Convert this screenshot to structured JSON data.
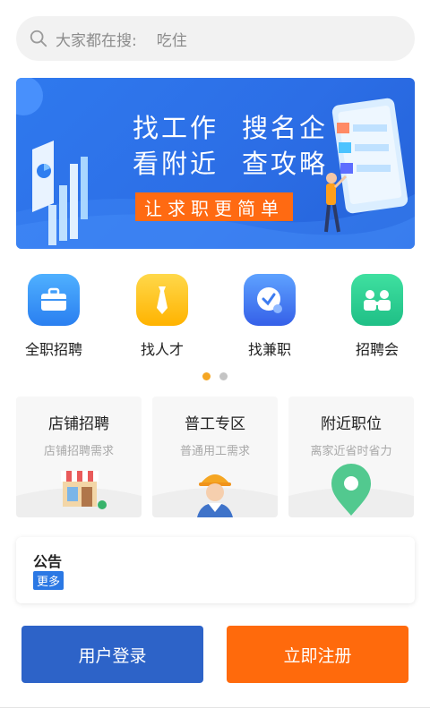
{
  "search": {
    "placeholder": "大家都在搜:",
    "hot_keyword": "吃住"
  },
  "banner": {
    "line1_a": "找工作",
    "line1_b": "搜名企",
    "line2_a": "看附近",
    "line2_b": "查攻略",
    "cta": "让求职更简单"
  },
  "categories": [
    {
      "label": "全职招聘",
      "icon": "briefcase-icon",
      "color": "#2d8cf0"
    },
    {
      "label": "找人才",
      "icon": "necktie-icon",
      "color": "#ffc21a"
    },
    {
      "label": "找兼职",
      "icon": "clock-icon",
      "color": "#3a7cf0"
    },
    {
      "label": "招聘会",
      "icon": "people-icon",
      "color": "#2ecc8b"
    }
  ],
  "pager": {
    "active_index": 0,
    "count": 2
  },
  "cards": [
    {
      "title": "店铺招聘",
      "subtitle": "店铺招聘需求",
      "icon": "shop-icon"
    },
    {
      "title": "普工专区",
      "subtitle": "普通用工需求",
      "icon": "worker-icon"
    },
    {
      "title": "附近职位",
      "subtitle": "离家近省时省力",
      "icon": "location-pin-icon"
    }
  ],
  "notice": {
    "title": "公告",
    "more": "更多"
  },
  "actions": {
    "login": "用户登录",
    "register": "立即注册"
  },
  "colors": {
    "brand_blue": "#2d63c8",
    "accent_orange": "#ff6a0c",
    "banner_blue": "#2c6ee6"
  }
}
